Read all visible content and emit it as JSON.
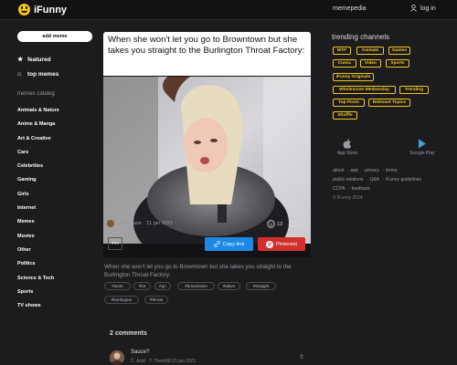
{
  "header": {
    "logo_text": "iFunny",
    "memepedia": "memepedia",
    "login": "log in"
  },
  "sidebar": {
    "add_meme": "add meme",
    "featured": "featured",
    "top_memes": "top memes",
    "catalog_title": "memes catalog",
    "categories": [
      "Animals & Nature",
      "Anime & Manga",
      "Art & Creative",
      "Cars",
      "Celebrities",
      "Gaming",
      "Girls",
      "Internet",
      "Memes",
      "Movies",
      "Other",
      "Politics",
      "Science & Tech",
      "Sports",
      "TV shows"
    ]
  },
  "post": {
    "caption": "When she won't let you go to Browntown but she takes you straight to the Burlington Throat Factory:",
    "author": "ZeusBane",
    "date": "21 jan 2021",
    "smiles": "13",
    "comments_count": "2",
    "more": "•••",
    "copy_link": "Copy link",
    "pinterest": "Pinterest",
    "description": "When she won't let you go to Browntown but she takes you straight to the Burlington Throat Factory:",
    "tags": [
      "#wont",
      "#let",
      "#go",
      "#browntown",
      "#takes",
      "#straight",
      "#burlington",
      "#throat"
    ]
  },
  "comments": {
    "title": "2 comments",
    "first": {
      "text": "Sauce?",
      "meta": "C. Acid · T. Them58 21 jan 2021"
    }
  },
  "right": {
    "title": "trending channels",
    "chips": [
      "WTF",
      "Animals",
      "Games",
      "Comic",
      "Video",
      "Sports",
      "iFunny Originals",
      "Wholesome Wednesday",
      "Trending",
      "Top Posts",
      "Relevant Topics",
      "Shuffle"
    ],
    "app_store": "App Store",
    "google_play": "Google Play",
    "links": [
      "about",
      "app",
      "privacy",
      "terms",
      "public relations",
      "Q&A",
      "iFunny guidelines",
      "CCPA",
      "feedback"
    ],
    "copyright": "© iFunny 2024"
  },
  "colors": {
    "accent": "#f5c518",
    "copy": "#1e88e5",
    "pinterest": "#d32f2f",
    "bg": "#1c1c1f"
  }
}
